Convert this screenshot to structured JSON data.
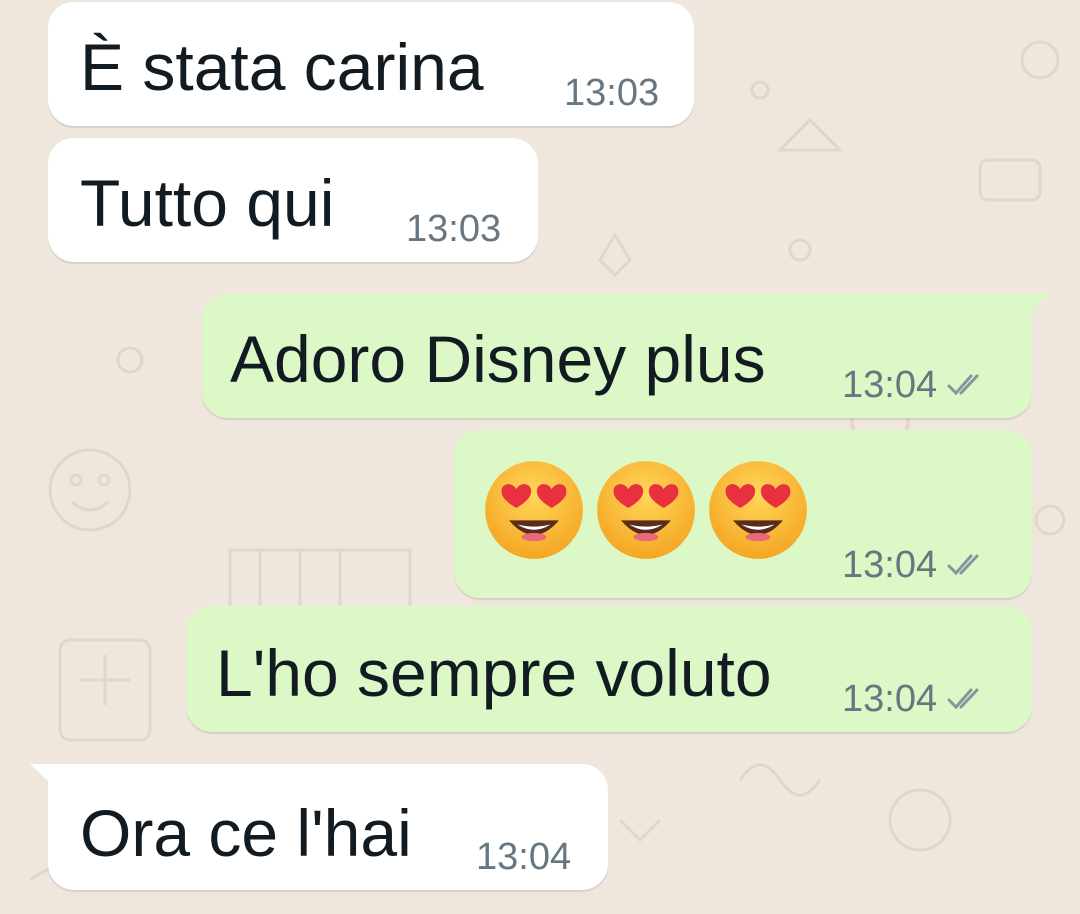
{
  "chat": {
    "messages": [
      {
        "text": "È stata carina",
        "time": "13:03",
        "direction": "incoming"
      },
      {
        "text": "Tutto qui",
        "time": "13:03",
        "direction": "incoming"
      },
      {
        "text": "Adoro Disney plus",
        "time": "13:04",
        "direction": "outgoing",
        "status": "read"
      },
      {
        "emoji": [
          "smiling-face-with-heart-eyes",
          "smiling-face-with-heart-eyes",
          "smiling-face-with-heart-eyes"
        ],
        "time": "13:04",
        "direction": "outgoing",
        "status": "read"
      },
      {
        "text": "L'ho sempre voluto",
        "time": "13:04",
        "direction": "outgoing",
        "status": "read"
      },
      {
        "text": "Ora ce l'hai",
        "time": "13:04",
        "direction": "incoming"
      }
    ]
  },
  "colors": {
    "background": "#efe7de",
    "incoming_bubble": "#ffffff",
    "outgoing_bubble": "#dcf8c6",
    "text": "#111b21",
    "meta": "#667781",
    "tick_delivered": "#8696a0"
  },
  "icons": {
    "status_tick": "double-check-icon"
  }
}
